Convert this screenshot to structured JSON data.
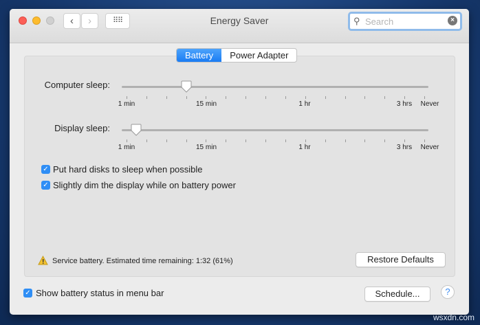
{
  "window": {
    "title": "Energy Saver"
  },
  "search": {
    "placeholder": "Search"
  },
  "tabs": [
    {
      "label": "Battery",
      "selected": true
    },
    {
      "label": "Power Adapter",
      "selected": false
    }
  ],
  "sliders": [
    {
      "label": "Computer sleep:",
      "tick_index": 3,
      "tick_count": 16
    },
    {
      "label": "Display sleep:",
      "tick_index": 0.5,
      "tick_count": 16
    }
  ],
  "tick_labels": [
    "1 min",
    "15 min",
    "1 hr",
    "3 hrs",
    "Never"
  ],
  "checkboxes": [
    {
      "label": "Put hard disks to sleep when possible",
      "checked": true
    },
    {
      "label": "Slightly dim the display while on battery power",
      "checked": true
    }
  ],
  "status": "Service battery. Estimated time remaining: 1:32 (61%)",
  "restore_defaults": "Restore Defaults",
  "show_battery": {
    "label": "Show battery status in menu bar",
    "checked": true
  },
  "schedule": "Schedule...",
  "help": "?",
  "watermark": "wsxdn.com"
}
